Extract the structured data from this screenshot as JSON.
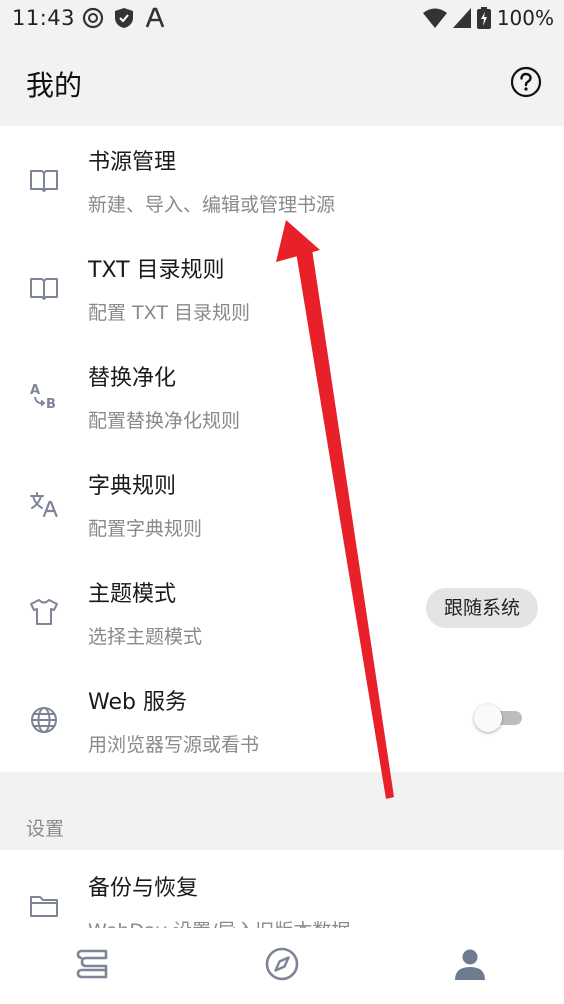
{
  "status_bar": {
    "time": "11:43",
    "battery_percent": "100%",
    "icons": [
      "dnd-icon",
      "shield-icon",
      "a-icon",
      "wifi-icon",
      "signal-icon",
      "battery-charging-icon"
    ]
  },
  "app_bar": {
    "title": "我的",
    "help_icon": "help-icon"
  },
  "items": [
    {
      "icon": "book-icon",
      "title": "书源管理",
      "subtitle": "新建、导入、编辑或管理书源"
    },
    {
      "icon": "book-icon",
      "title": "TXT 目录规则",
      "subtitle": "配置 TXT 目录规则"
    },
    {
      "icon": "replace-ab-icon",
      "title": "替换净化",
      "subtitle": "配置替换净化规则"
    },
    {
      "icon": "translate-icon",
      "title": "字典规则",
      "subtitle": "配置字典规则"
    },
    {
      "icon": "shirt-icon",
      "title": "主题模式",
      "subtitle": "选择主题模式",
      "value": "跟随系统"
    },
    {
      "icon": "globe-icon",
      "title": "Web 服务",
      "subtitle": "用浏览器写源或看书",
      "toggle": false
    }
  ],
  "settings": {
    "header": "设置",
    "items": [
      {
        "icon": "folder-icon",
        "title": "备份与恢复",
        "subtitle": "WebDav 设置/导入旧版本数据"
      }
    ]
  },
  "bottom_nav": [
    {
      "icon": "bookshelf-icon",
      "active": false
    },
    {
      "icon": "compass-icon",
      "active": false
    },
    {
      "icon": "person-icon",
      "active": true
    }
  ],
  "colors": {
    "background": "#f2f2f2",
    "card": "#ffffff",
    "icon": "#7d8597",
    "active_nav": "#6f7b8f",
    "annotation_arrow": "#e8202a"
  }
}
